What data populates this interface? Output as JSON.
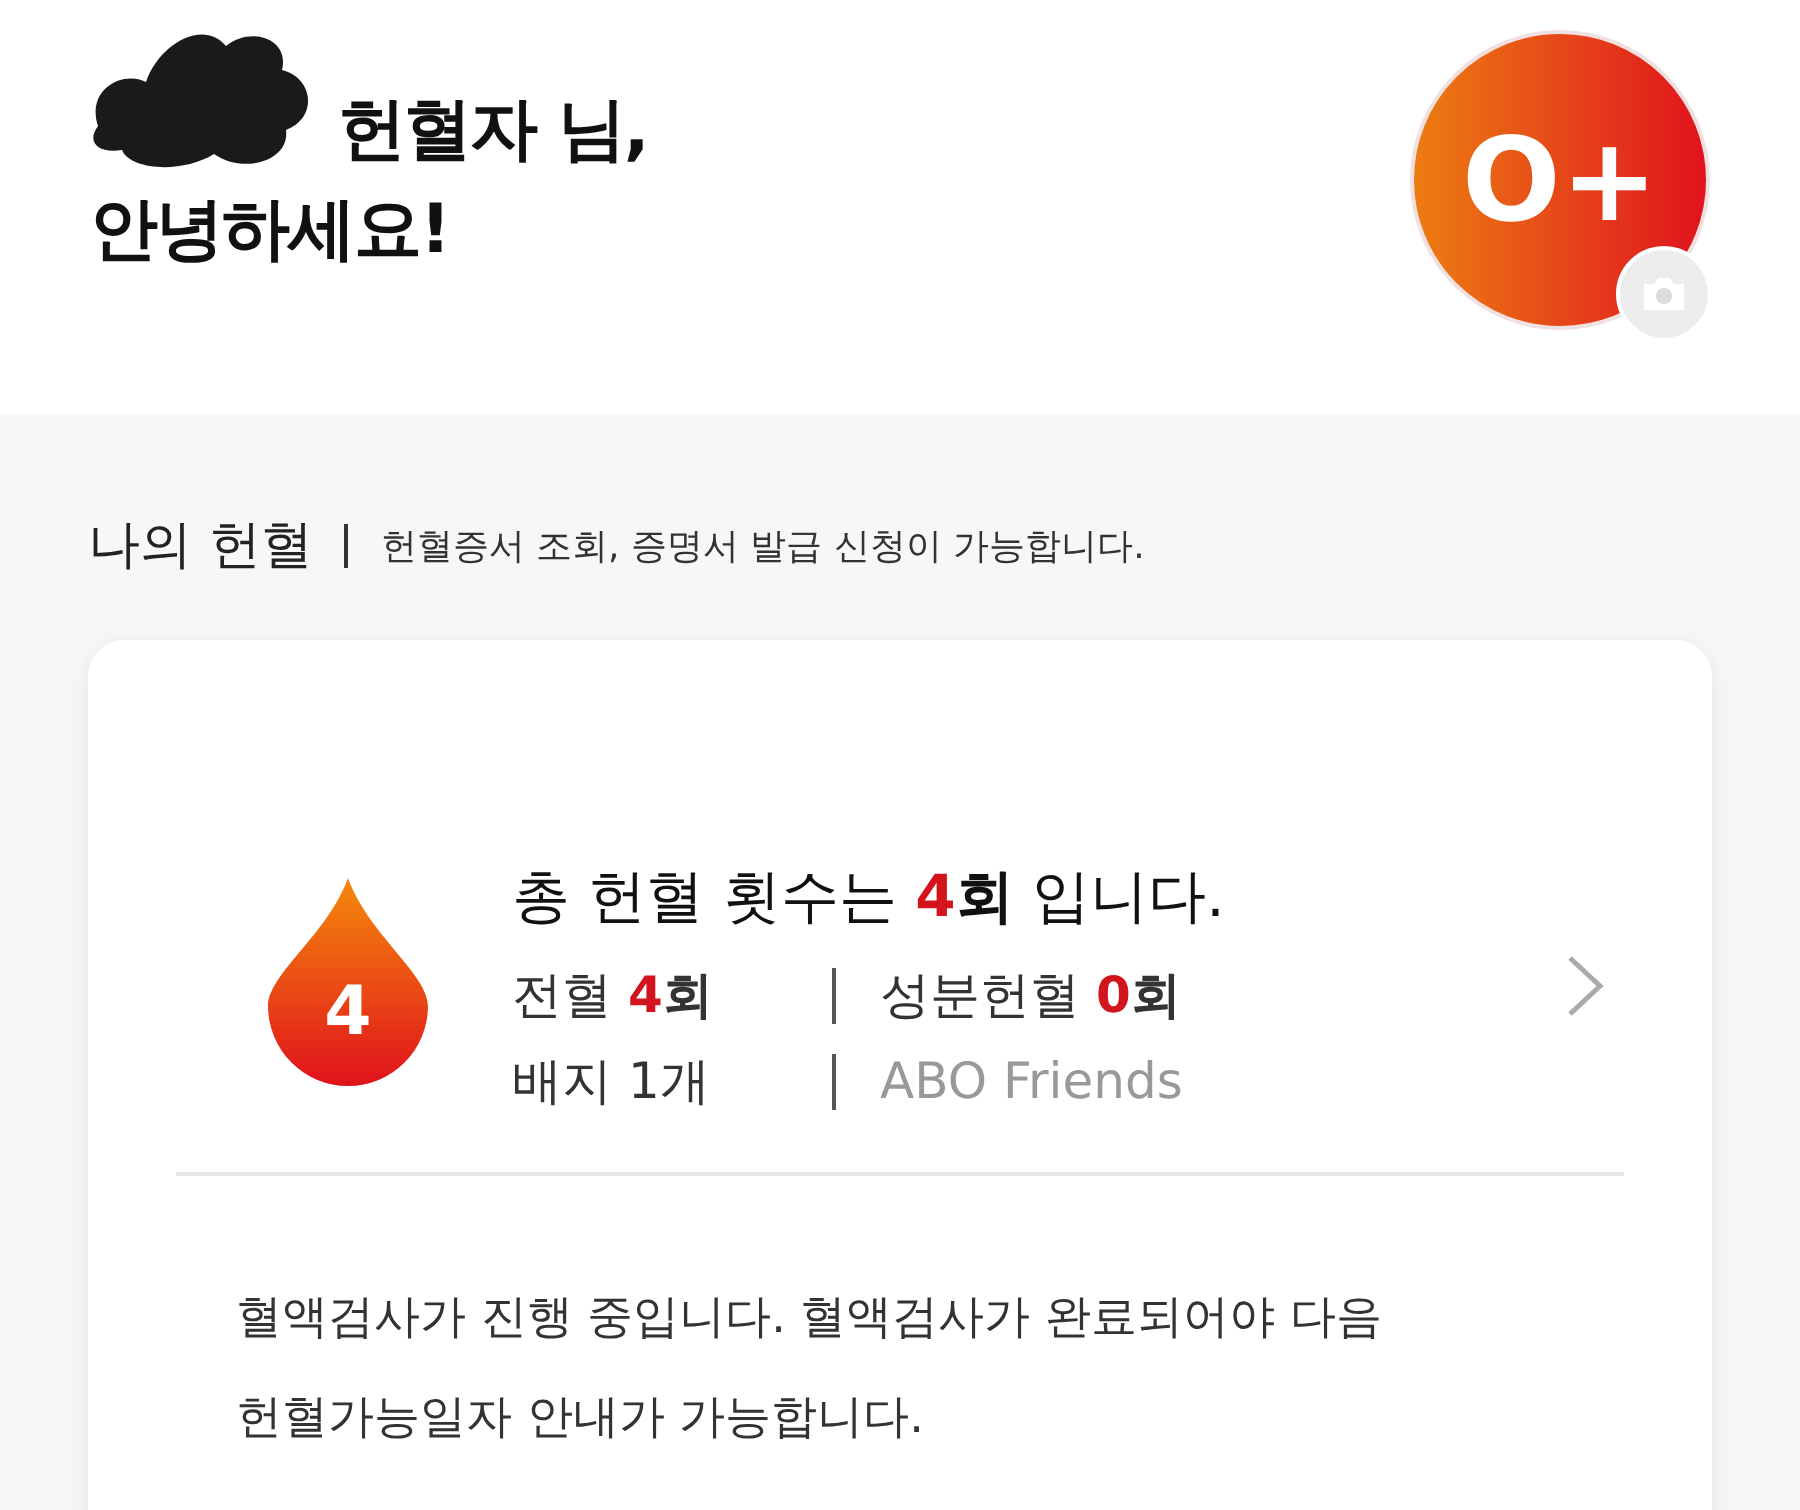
{
  "greeting": {
    "line1": "헌혈자 님,",
    "line2": "안녕하세요!",
    "name_redacted": true
  },
  "profile": {
    "blood_type": "O+"
  },
  "section": {
    "title": "나의 헌혈",
    "description": "헌혈증서 조회, 증명서 발급 신청이 가능합니다."
  },
  "summary": {
    "drop_count": "4",
    "prefix": "총 헌혈 횟수는",
    "count": "4",
    "unit": "회",
    "suffix": "입니다.",
    "stats": [
      {
        "label": "전혈",
        "count": "4",
        "unit": "회"
      },
      {
        "label": "성분헌혈",
        "count": "0",
        "unit": "회"
      }
    ],
    "badge": "배지 1개",
    "group": "ABO Friends"
  },
  "notice": "혈액검사가 진행 중입니다. 혈액검사가 완료되어야 다음 헌혈가능일자 안내가 가능합니다."
}
